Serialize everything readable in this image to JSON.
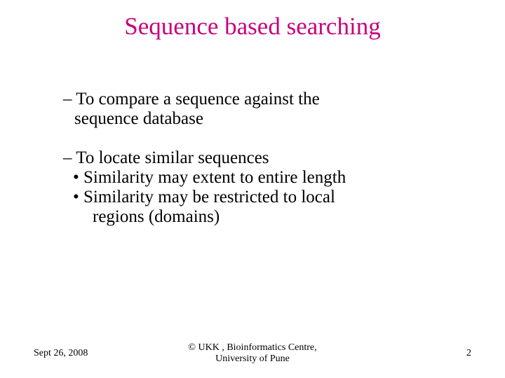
{
  "title": "Sequence based searching",
  "body": {
    "p1": {
      "line1": "– To compare a sequence against the",
      "line2": "sequence database"
    },
    "p2": {
      "line1": "– To locate similar sequences",
      "bullet1": "• Similarity may extent to entire length",
      "bullet2a": "• Similarity may be restricted to local",
      "bullet2b": "regions (domains)"
    }
  },
  "footer": {
    "date": "Sept 26, 2008",
    "center_line1": "© UKK , Bioinformatics Centre,",
    "center_line2": "University of Pune",
    "page": "2"
  }
}
